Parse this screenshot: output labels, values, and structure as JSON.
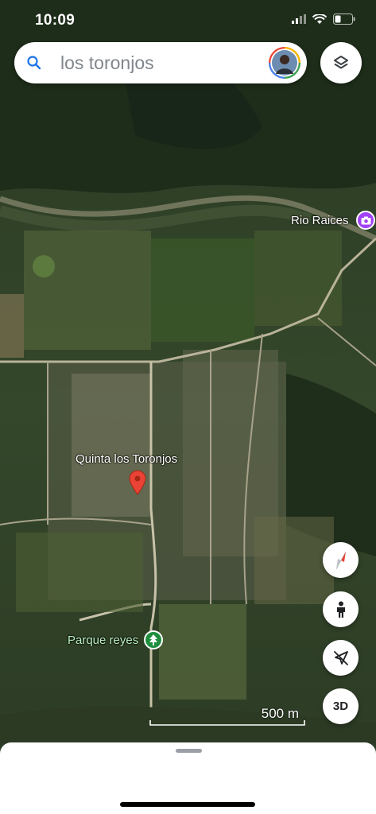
{
  "status_bar": {
    "time": "10:09"
  },
  "search": {
    "query": "los toronjos"
  },
  "map": {
    "labels": {
      "rio": "Rio Raices",
      "quinta": "Quinta los Toronjos",
      "parque": "Parque reyes"
    },
    "scale_label": "500 m"
  },
  "controls": {
    "three_d_label": "3D"
  },
  "icons": [
    "search-icon",
    "layers-icon",
    "compass-icon",
    "pegman-icon",
    "location-off-icon",
    "camera-icon",
    "tree-icon",
    "map-pin-icon"
  ],
  "colors": {
    "accent_blue": "#1a73e8",
    "pin_red": "#ea4335",
    "poi_purple": "#a142f4",
    "poi_green": "#1e8e3e"
  }
}
